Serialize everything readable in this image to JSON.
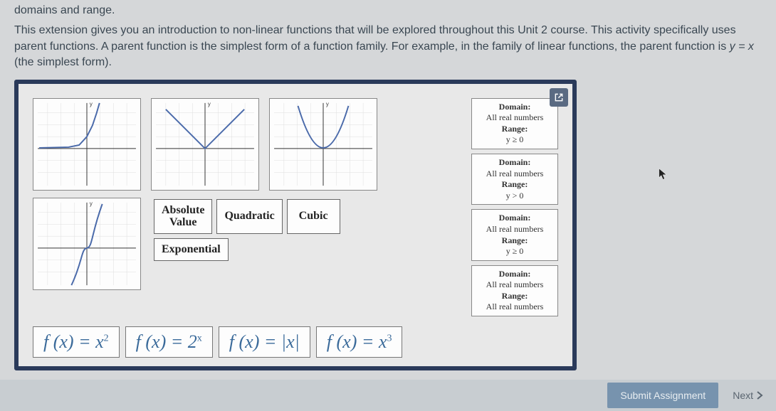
{
  "header": {
    "partial_line": "domains and range.",
    "paragraph_1": "This extension gives you an introduction to non-linear functions that will be explored throughout this Unit 2 course. This activity specifically uses parent functions. A parent function is the simplest form of a function family. For example, in the family of linear functions, the parent function is ",
    "paragraph_italic": "y = x",
    "paragraph_2": " (the simplest form)."
  },
  "tiles": {
    "absolute_l1": "Absolute",
    "absolute_l2": "Value",
    "quadratic": "Quadratic",
    "cubic": "Cubic",
    "exponential": "Exponential"
  },
  "domain_boxes": [
    {
      "d_label": "Domain:",
      "d_val": "All real numbers",
      "r_label": "Range:",
      "r_val": "y ≥ 0"
    },
    {
      "d_label": "Domain:",
      "d_val": "All real numbers",
      "r_label": "Range:",
      "r_val": "y > 0"
    },
    {
      "d_label": "Domain:",
      "d_val": "All real numbers",
      "r_label": "Range:",
      "r_val": "y ≥ 0"
    },
    {
      "d_label": "Domain:",
      "d_val": "All real numbers",
      "r_label": "Range:",
      "r_val": "All real numbers"
    }
  ],
  "equations": {
    "eq1_pre": "f (x) = x",
    "eq1_sup": "2",
    "eq2_pre": "f (x) = 2",
    "eq2_sup": "x",
    "eq3": "f (x) = |x|",
    "eq4_pre": "f (x) = x",
    "eq4_sup": "3"
  },
  "footer": {
    "submit": "Submit Assignment",
    "next": "Next"
  }
}
